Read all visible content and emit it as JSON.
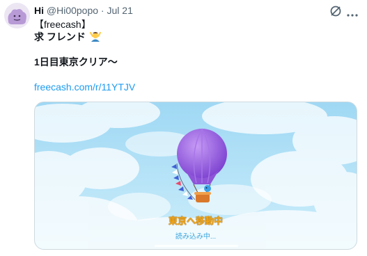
{
  "tweet": {
    "display_name": "Hi",
    "handle": "@Hi00popo",
    "separator": " · ",
    "date": "Jul 21",
    "lines": [
      "【freecash】",
      "求 フレンド",
      "1日目東京クリア〜"
    ],
    "link": "freecash.com/r/11YTJV"
  },
  "media": {
    "status_text": "東京へ移動中",
    "loading_text": "読み込み中..."
  },
  "icons": {
    "avatar": "ditto-avatar",
    "grok": "grok-icon",
    "more": "more-icon",
    "emoji": "person-raising-hands-emoji",
    "balloon": "hot-air-balloon"
  },
  "colors": {
    "link": "#1d9bf0",
    "status": "#f2a51a",
    "balloon": "#8e55d8"
  }
}
